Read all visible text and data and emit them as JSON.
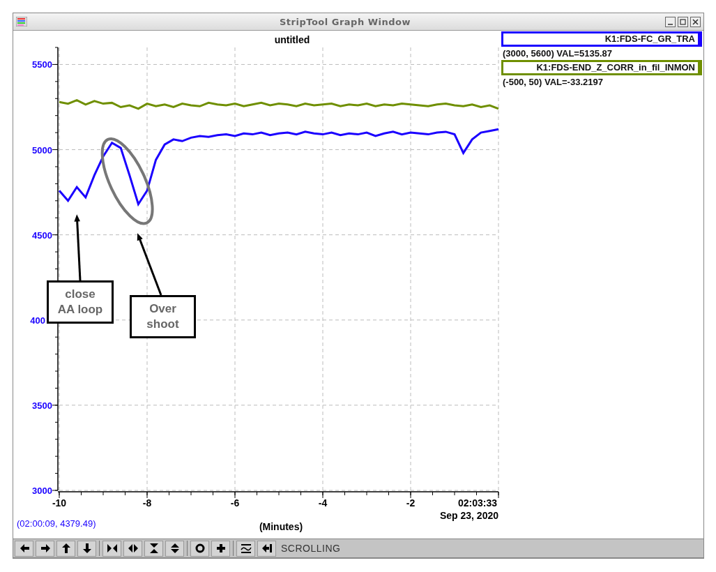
{
  "window": {
    "title": "StripTool Graph Window"
  },
  "graph": {
    "chart_data": {
      "type": "line",
      "title": "untitled",
      "xlabel": "(Minutes)",
      "x": [
        -10,
        -9.8,
        -9.6,
        -9.4,
        -9.2,
        -9,
        -8.8,
        -8.6,
        -8.4,
        -8.2,
        -8,
        -7.8,
        -7.6,
        -7.4,
        -7.2,
        -7,
        -6.8,
        -6.6,
        -6.4,
        -6.2,
        -6,
        -5.8,
        -5.6,
        -5.4,
        -5.2,
        -5,
        -4.8,
        -4.6,
        -4.4,
        -4.2,
        -4,
        -3.8,
        -3.6,
        -3.4,
        -3.2,
        -3,
        -2.8,
        -2.6,
        -2.4,
        -2.2,
        -2,
        -1.8,
        -1.6,
        -1.4,
        -1.2,
        -1,
        -0.8,
        -0.6,
        -0.4,
        -0.2,
        0
      ],
      "series": [
        {
          "name": "K1:FDS-FC_GR_TRA",
          "color": "#1a00ff",
          "values": [
            4760,
            4700,
            4780,
            4720,
            4850,
            4960,
            5040,
            5010,
            4850,
            4680,
            4760,
            4940,
            5030,
            5060,
            5050,
            5070,
            5080,
            5075,
            5085,
            5090,
            5080,
            5095,
            5090,
            5100,
            5085,
            5095,
            5100,
            5090,
            5105,
            5095,
            5090,
            5100,
            5085,
            5095,
            5090,
            5100,
            5080,
            5095,
            5105,
            5090,
            5100,
            5095,
            5090,
            5100,
            5105,
            5090,
            4980,
            5060,
            5100,
            5110,
            5120
          ]
        },
        {
          "name": "K1:FDS-END_Z_CORR_in_fil_INMON",
          "color": "#6f8f00",
          "values": [
            5280,
            5270,
            5290,
            5265,
            5285,
            5270,
            5275,
            5250,
            5260,
            5240,
            5270,
            5255,
            5265,
            5250,
            5270,
            5260,
            5255,
            5275,
            5265,
            5260,
            5270,
            5255,
            5265,
            5275,
            5260,
            5270,
            5265,
            5255,
            5270,
            5260,
            5265,
            5270,
            5255,
            5265,
            5260,
            5270,
            5255,
            5265,
            5260,
            5270,
            5265,
            5260,
            5255,
            5265,
            5270,
            5260,
            5255,
            5265,
            5250,
            5260,
            5240
          ]
        }
      ],
      "xlim": [
        -10,
        0
      ],
      "ylim": [
        3000,
        5600
      ],
      "xticks": [
        -10,
        -8,
        -6,
        -4,
        -2
      ],
      "yticks": [
        3000,
        3500,
        4500,
        5000,
        5500
      ],
      "grid": true,
      "legend": "right",
      "annotations": [
        "close AA loop",
        "Over shoot"
      ]
    },
    "covered_tick_label": "400",
    "end_time": "02:03:33",
    "date": "Sep 23, 2020",
    "cursor_readout": "(02:00:09, 4379.49)"
  },
  "legend": [
    {
      "info": "(3000, 5600) VAL=5135.87"
    },
    {
      "info": "(-500, 50) VAL=-33.2197"
    }
  ],
  "toolbar": {
    "mode": "SCROLLING"
  }
}
